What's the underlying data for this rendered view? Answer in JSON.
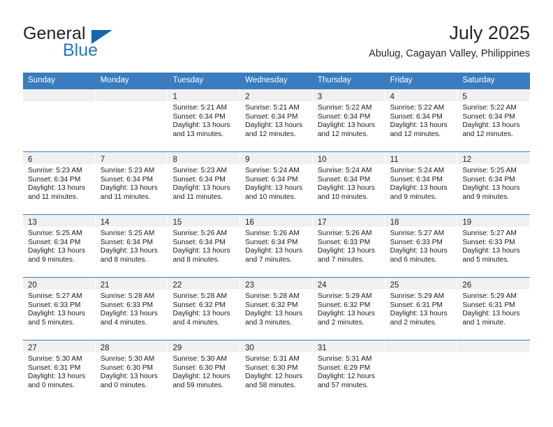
{
  "brand": {
    "name_part1": "General",
    "name_part2": "Blue",
    "triangle_icon": "triangle-icon",
    "accent_color": "#1c7ac9",
    "header_color": "#3a7cbd"
  },
  "header": {
    "month_title": "July 2025",
    "location": "Abulug, Cagayan Valley, Philippines"
  },
  "weekdays": [
    "Sunday",
    "Monday",
    "Tuesday",
    "Wednesday",
    "Thursday",
    "Friday",
    "Saturday"
  ],
  "labels": {
    "sunrise": "Sunrise:",
    "sunset": "Sunset:",
    "daylight": "Daylight:"
  },
  "weeks": [
    {
      "days": [
        {
          "num": "",
          "sunrise": "",
          "sunset": "",
          "daylight1": "",
          "daylight2": "",
          "empty": true
        },
        {
          "num": "",
          "sunrise": "",
          "sunset": "",
          "daylight1": "",
          "daylight2": "",
          "empty": true
        },
        {
          "num": "1",
          "sunrise": "Sunrise: 5:21 AM",
          "sunset": "Sunset: 6:34 PM",
          "daylight1": "Daylight: 13 hours",
          "daylight2": "and 13 minutes.",
          "empty": false
        },
        {
          "num": "2",
          "sunrise": "Sunrise: 5:21 AM",
          "sunset": "Sunset: 6:34 PM",
          "daylight1": "Daylight: 13 hours",
          "daylight2": "and 12 minutes.",
          "empty": false
        },
        {
          "num": "3",
          "sunrise": "Sunrise: 5:22 AM",
          "sunset": "Sunset: 6:34 PM",
          "daylight1": "Daylight: 13 hours",
          "daylight2": "and 12 minutes.",
          "empty": false
        },
        {
          "num": "4",
          "sunrise": "Sunrise: 5:22 AM",
          "sunset": "Sunset: 6:34 PM",
          "daylight1": "Daylight: 13 hours",
          "daylight2": "and 12 minutes.",
          "empty": false
        },
        {
          "num": "5",
          "sunrise": "Sunrise: 5:22 AM",
          "sunset": "Sunset: 6:34 PM",
          "daylight1": "Daylight: 13 hours",
          "daylight2": "and 12 minutes.",
          "empty": false
        }
      ]
    },
    {
      "days": [
        {
          "num": "6",
          "sunrise": "Sunrise: 5:23 AM",
          "sunset": "Sunset: 6:34 PM",
          "daylight1": "Daylight: 13 hours",
          "daylight2": "and 11 minutes.",
          "empty": false
        },
        {
          "num": "7",
          "sunrise": "Sunrise: 5:23 AM",
          "sunset": "Sunset: 6:34 PM",
          "daylight1": "Daylight: 13 hours",
          "daylight2": "and 11 minutes.",
          "empty": false
        },
        {
          "num": "8",
          "sunrise": "Sunrise: 5:23 AM",
          "sunset": "Sunset: 6:34 PM",
          "daylight1": "Daylight: 13 hours",
          "daylight2": "and 11 minutes.",
          "empty": false
        },
        {
          "num": "9",
          "sunrise": "Sunrise: 5:24 AM",
          "sunset": "Sunset: 6:34 PM",
          "daylight1": "Daylight: 13 hours",
          "daylight2": "and 10 minutes.",
          "empty": false
        },
        {
          "num": "10",
          "sunrise": "Sunrise: 5:24 AM",
          "sunset": "Sunset: 6:34 PM",
          "daylight1": "Daylight: 13 hours",
          "daylight2": "and 10 minutes.",
          "empty": false
        },
        {
          "num": "11",
          "sunrise": "Sunrise: 5:24 AM",
          "sunset": "Sunset: 6:34 PM",
          "daylight1": "Daylight: 13 hours",
          "daylight2": "and 9 minutes.",
          "empty": false
        },
        {
          "num": "12",
          "sunrise": "Sunrise: 5:25 AM",
          "sunset": "Sunset: 6:34 PM",
          "daylight1": "Daylight: 13 hours",
          "daylight2": "and 9 minutes.",
          "empty": false
        }
      ]
    },
    {
      "days": [
        {
          "num": "13",
          "sunrise": "Sunrise: 5:25 AM",
          "sunset": "Sunset: 6:34 PM",
          "daylight1": "Daylight: 13 hours",
          "daylight2": "and 9 minutes.",
          "empty": false
        },
        {
          "num": "14",
          "sunrise": "Sunrise: 5:25 AM",
          "sunset": "Sunset: 6:34 PM",
          "daylight1": "Daylight: 13 hours",
          "daylight2": "and 8 minutes.",
          "empty": false
        },
        {
          "num": "15",
          "sunrise": "Sunrise: 5:26 AM",
          "sunset": "Sunset: 6:34 PM",
          "daylight1": "Daylight: 13 hours",
          "daylight2": "and 8 minutes.",
          "empty": false
        },
        {
          "num": "16",
          "sunrise": "Sunrise: 5:26 AM",
          "sunset": "Sunset: 6:34 PM",
          "daylight1": "Daylight: 13 hours",
          "daylight2": "and 7 minutes.",
          "empty": false
        },
        {
          "num": "17",
          "sunrise": "Sunrise: 5:26 AM",
          "sunset": "Sunset: 6:33 PM",
          "daylight1": "Daylight: 13 hours",
          "daylight2": "and 7 minutes.",
          "empty": false
        },
        {
          "num": "18",
          "sunrise": "Sunrise: 5:27 AM",
          "sunset": "Sunset: 6:33 PM",
          "daylight1": "Daylight: 13 hours",
          "daylight2": "and 6 minutes.",
          "empty": false
        },
        {
          "num": "19",
          "sunrise": "Sunrise: 5:27 AM",
          "sunset": "Sunset: 6:33 PM",
          "daylight1": "Daylight: 13 hours",
          "daylight2": "and 5 minutes.",
          "empty": false
        }
      ]
    },
    {
      "days": [
        {
          "num": "20",
          "sunrise": "Sunrise: 5:27 AM",
          "sunset": "Sunset: 6:33 PM",
          "daylight1": "Daylight: 13 hours",
          "daylight2": "and 5 minutes.",
          "empty": false
        },
        {
          "num": "21",
          "sunrise": "Sunrise: 5:28 AM",
          "sunset": "Sunset: 6:33 PM",
          "daylight1": "Daylight: 13 hours",
          "daylight2": "and 4 minutes.",
          "empty": false
        },
        {
          "num": "22",
          "sunrise": "Sunrise: 5:28 AM",
          "sunset": "Sunset: 6:32 PM",
          "daylight1": "Daylight: 13 hours",
          "daylight2": "and 4 minutes.",
          "empty": false
        },
        {
          "num": "23",
          "sunrise": "Sunrise: 5:28 AM",
          "sunset": "Sunset: 6:32 PM",
          "daylight1": "Daylight: 13 hours",
          "daylight2": "and 3 minutes.",
          "empty": false
        },
        {
          "num": "24",
          "sunrise": "Sunrise: 5:29 AM",
          "sunset": "Sunset: 6:32 PM",
          "daylight1": "Daylight: 13 hours",
          "daylight2": "and 2 minutes.",
          "empty": false
        },
        {
          "num": "25",
          "sunrise": "Sunrise: 5:29 AM",
          "sunset": "Sunset: 6:31 PM",
          "daylight1": "Daylight: 13 hours",
          "daylight2": "and 2 minutes.",
          "empty": false
        },
        {
          "num": "26",
          "sunrise": "Sunrise: 5:29 AM",
          "sunset": "Sunset: 6:31 PM",
          "daylight1": "Daylight: 13 hours",
          "daylight2": "and 1 minute.",
          "empty": false
        }
      ]
    },
    {
      "days": [
        {
          "num": "27",
          "sunrise": "Sunrise: 5:30 AM",
          "sunset": "Sunset: 6:31 PM",
          "daylight1": "Daylight: 13 hours",
          "daylight2": "and 0 minutes.",
          "empty": false
        },
        {
          "num": "28",
          "sunrise": "Sunrise: 5:30 AM",
          "sunset": "Sunset: 6:30 PM",
          "daylight1": "Daylight: 13 hours",
          "daylight2": "and 0 minutes.",
          "empty": false
        },
        {
          "num": "29",
          "sunrise": "Sunrise: 5:30 AM",
          "sunset": "Sunset: 6:30 PM",
          "daylight1": "Daylight: 12 hours",
          "daylight2": "and 59 minutes.",
          "empty": false
        },
        {
          "num": "30",
          "sunrise": "Sunrise: 5:31 AM",
          "sunset": "Sunset: 6:30 PM",
          "daylight1": "Daylight: 12 hours",
          "daylight2": "and 58 minutes.",
          "empty": false
        },
        {
          "num": "31",
          "sunrise": "Sunrise: 5:31 AM",
          "sunset": "Sunset: 6:29 PM",
          "daylight1": "Daylight: 12 hours",
          "daylight2": "and 57 minutes.",
          "empty": false
        },
        {
          "num": "",
          "sunrise": "",
          "sunset": "",
          "daylight1": "",
          "daylight2": "",
          "empty": true
        },
        {
          "num": "",
          "sunrise": "",
          "sunset": "",
          "daylight1": "",
          "daylight2": "",
          "empty": true
        }
      ]
    }
  ]
}
